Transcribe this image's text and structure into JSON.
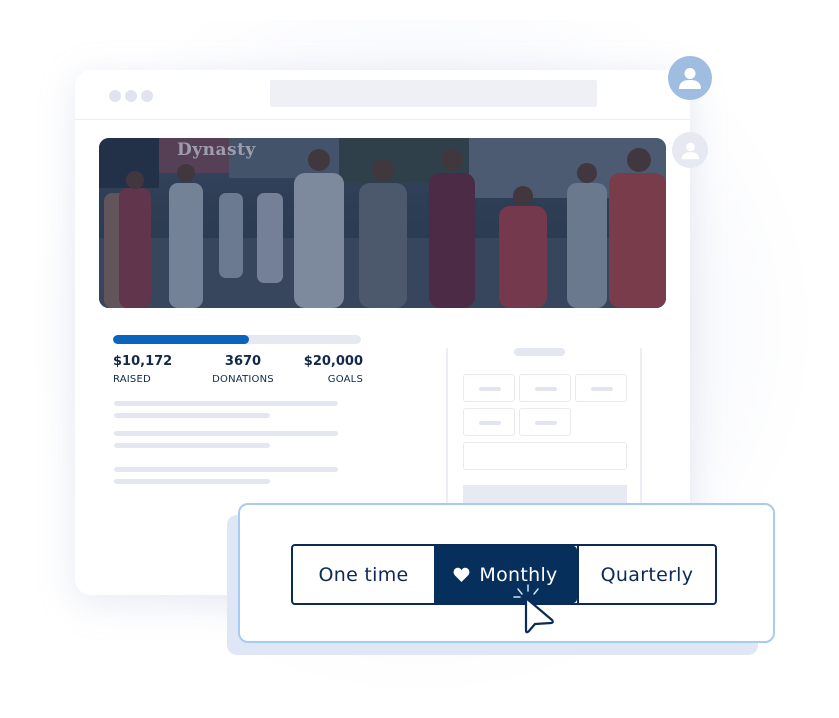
{
  "browser": {
    "window_controls": [
      "dot",
      "dot",
      "dot"
    ],
    "address_bar": ""
  },
  "hero": {
    "image_alt": "Crowd of people standing in a city street",
    "sign_text": "Dynasty"
  },
  "campaign": {
    "progress_fraction": 0.55,
    "stats": [
      {
        "value": "$10,172",
        "label": "RAISED"
      },
      {
        "value": "3670",
        "label": "DONATIONS"
      },
      {
        "value": "$20,000",
        "label": "GOALS"
      }
    ],
    "accent_color": "#0a63bd"
  },
  "donation_form": {
    "amount_options": [
      "",
      "",
      "",
      "",
      ""
    ],
    "custom_amount": "",
    "submit_label": ""
  },
  "avatars": [
    {
      "icon": "user-icon"
    },
    {
      "icon": "user-icon"
    }
  ],
  "frequency": {
    "options": [
      {
        "label": "One time",
        "selected": false
      },
      {
        "label": "Monthly",
        "selected": true,
        "icon": "heart-icon"
      },
      {
        "label": "Quarterly",
        "selected": false
      }
    ],
    "selected_color": "#072f5c"
  }
}
